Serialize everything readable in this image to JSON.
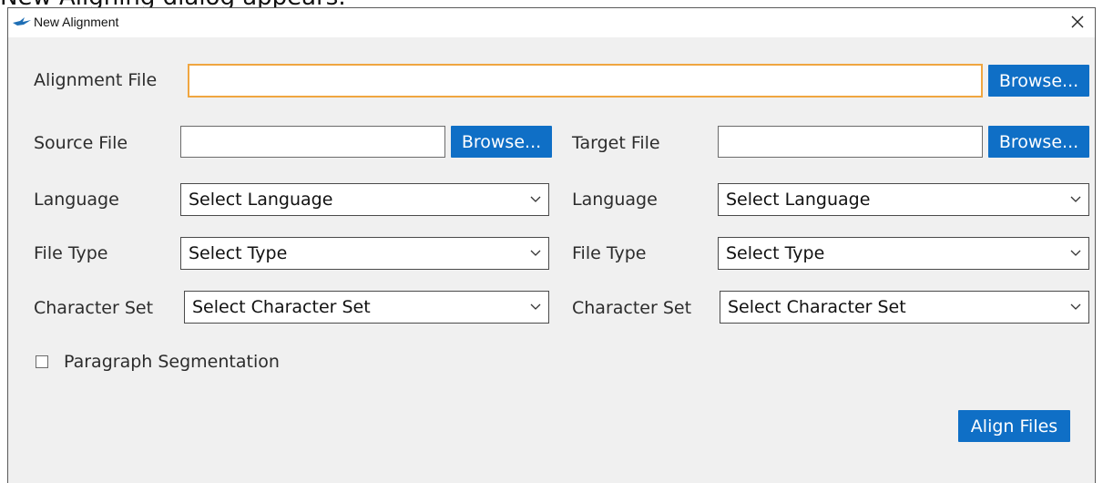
{
  "above_text": "New Aligning dialog appears.",
  "window": {
    "title": "New Alignment",
    "app_icon": "bird-logo-icon",
    "close_icon": "close-icon"
  },
  "alignment": {
    "label": "Alignment File",
    "value": "",
    "browse_label": "Browse..."
  },
  "source": {
    "file_label": "Source File",
    "file_value": "",
    "browse_label": "Browse...",
    "language_label": "Language",
    "language_value": "Select Language",
    "filetype_label": "File Type",
    "filetype_value": "Select Type",
    "charset_label": "Character Set",
    "charset_value": "Select Character Set"
  },
  "target": {
    "file_label": "Target File",
    "file_value": "",
    "browse_label": "Browse...",
    "language_label": "Language",
    "language_value": "Select Language",
    "filetype_label": "File Type",
    "filetype_value": "Select Type",
    "charset_label": "Character Set",
    "charset_value": "Select Character Set"
  },
  "paragraph_segmentation": {
    "label": "Paragraph Segmentation",
    "checked": false
  },
  "align_button_label": "Align Files",
  "colors": {
    "accent": "#0f6fc6",
    "focus_border": "#f0a640",
    "dialog_bg": "#f0f0f0"
  }
}
